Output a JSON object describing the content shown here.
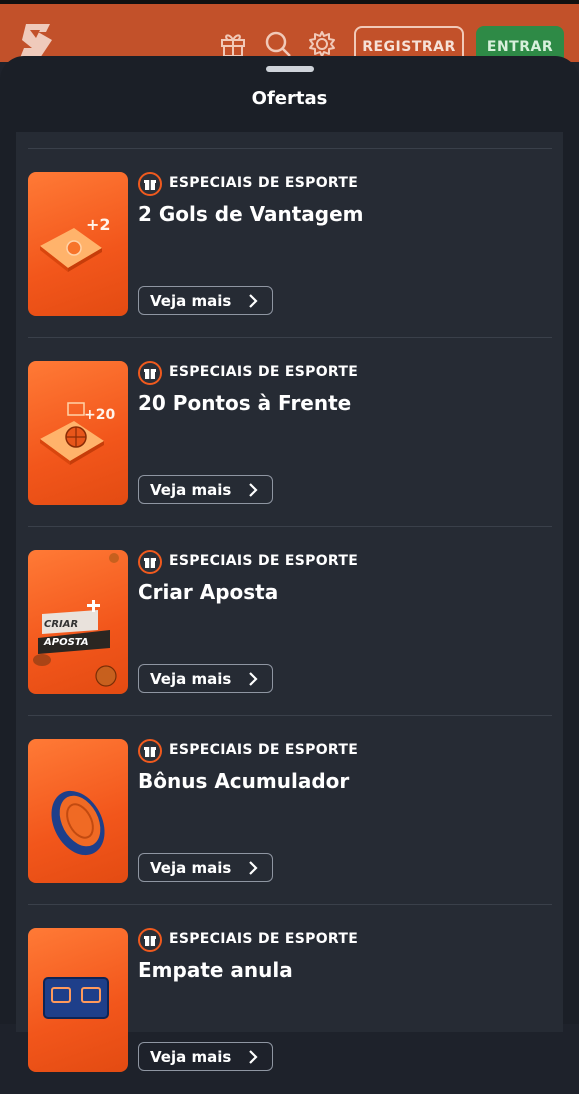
{
  "header": {
    "register_label": "REGISTRAR",
    "enter_label": "ENTRAR",
    "icons": [
      "logo-icon",
      "gift-icon",
      "search-icon",
      "gear-icon"
    ],
    "colors": {
      "bar": "#c2512a",
      "enter": "#2e8a46"
    }
  },
  "sheet": {
    "title": "Ofertas"
  },
  "offers": [
    {
      "category": "ESPECIAIS DE ESPORTE",
      "title": "2 Gols de Vantagem",
      "button": "Veja mais",
      "thumb_icon": "soccer-plus-2-icon",
      "thumb_text": "+2"
    },
    {
      "category": "ESPECIAIS DE ESPORTE",
      "title": "20 Pontos à Frente",
      "button": "Veja mais",
      "thumb_icon": "basketball-plus-20-icon",
      "thumb_text": "+20"
    },
    {
      "category": "ESPECIAIS DE ESPORTE",
      "title": "Criar Aposta",
      "button": "Veja mais",
      "thumb_icon": "criar-aposta-icon",
      "thumb_text_1": "CRIAR",
      "thumb_text_2": "APOSTA"
    },
    {
      "category": "ESPECIAIS DE ESPORTE",
      "title": "Bônus Acumulador",
      "button": "Veja mais",
      "thumb_icon": "coin-icon"
    },
    {
      "category": "ESPECIAIS DE ESPORTE",
      "title": "Empate anula",
      "button": "Veja mais",
      "thumb_icon": "scoreboard-icon"
    }
  ]
}
